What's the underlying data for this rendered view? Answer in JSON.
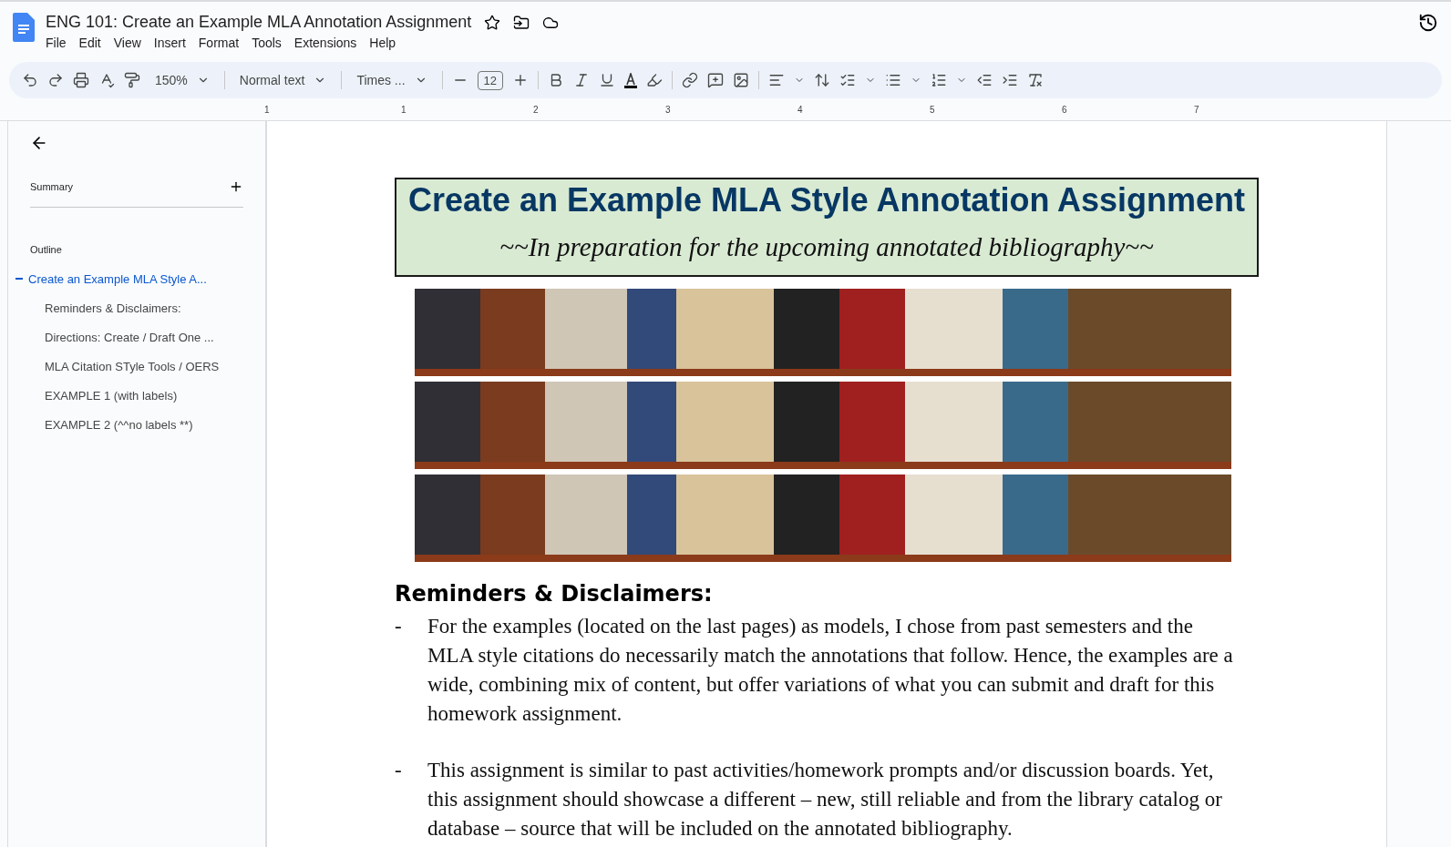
{
  "doc_title": "ENG 101: Create an Example MLA Annotation Assignment",
  "menu": [
    "File",
    "Edit",
    "View",
    "Insert",
    "Format",
    "Tools",
    "Extensions",
    "Help"
  ],
  "toolbar": {
    "zoom": "150%",
    "style": "Normal text",
    "font": "Times ...",
    "font_size": "12"
  },
  "ruler": [
    "1",
    "1",
    "2",
    "3",
    "4",
    "5",
    "6",
    "7"
  ],
  "sidebar": {
    "summary": "Summary",
    "outline_label": "Outline",
    "outline": [
      {
        "label": "Create an Example MLA Style A...",
        "selected": true,
        "children": [
          {
            "label": "Reminders & Disclaimers:",
            "selected": false
          },
          {
            "label": "Directions: Create / Draft One ...",
            "selected": false
          },
          {
            "label": "MLA Citation STyle Tools / OERS",
            "selected": false
          },
          {
            "label": "EXAMPLE 1 (with labels)",
            "selected": false
          },
          {
            "label": "EXAMPLE 2 (^^no labels **)",
            "selected": false
          }
        ]
      }
    ]
  },
  "document": {
    "title": "Create an Example MLA Style Annotation Assignment",
    "subtitle": "~~In preparation for the upcoming annotated bibliography~~",
    "heading": "Reminders & Disclaimers:",
    "bullets": [
      {
        "marker": "-",
        "text": "For the examples (located on the last pages) as models, I chose from past semesters and the MLA style citations do necessarily match the annotations that follow. Hence, the examples are a wide, combining mix of content, but offer variations of what you can submit and draft for this homework assignment."
      },
      {
        "marker": "-",
        "text": "This assignment is similar to past activities/homework prompts and/or discussion boards. Yet, this assignment should showcase a different – new, still reliable and from the library catalog or database – source that will be included on the annotated bibliography."
      }
    ]
  }
}
